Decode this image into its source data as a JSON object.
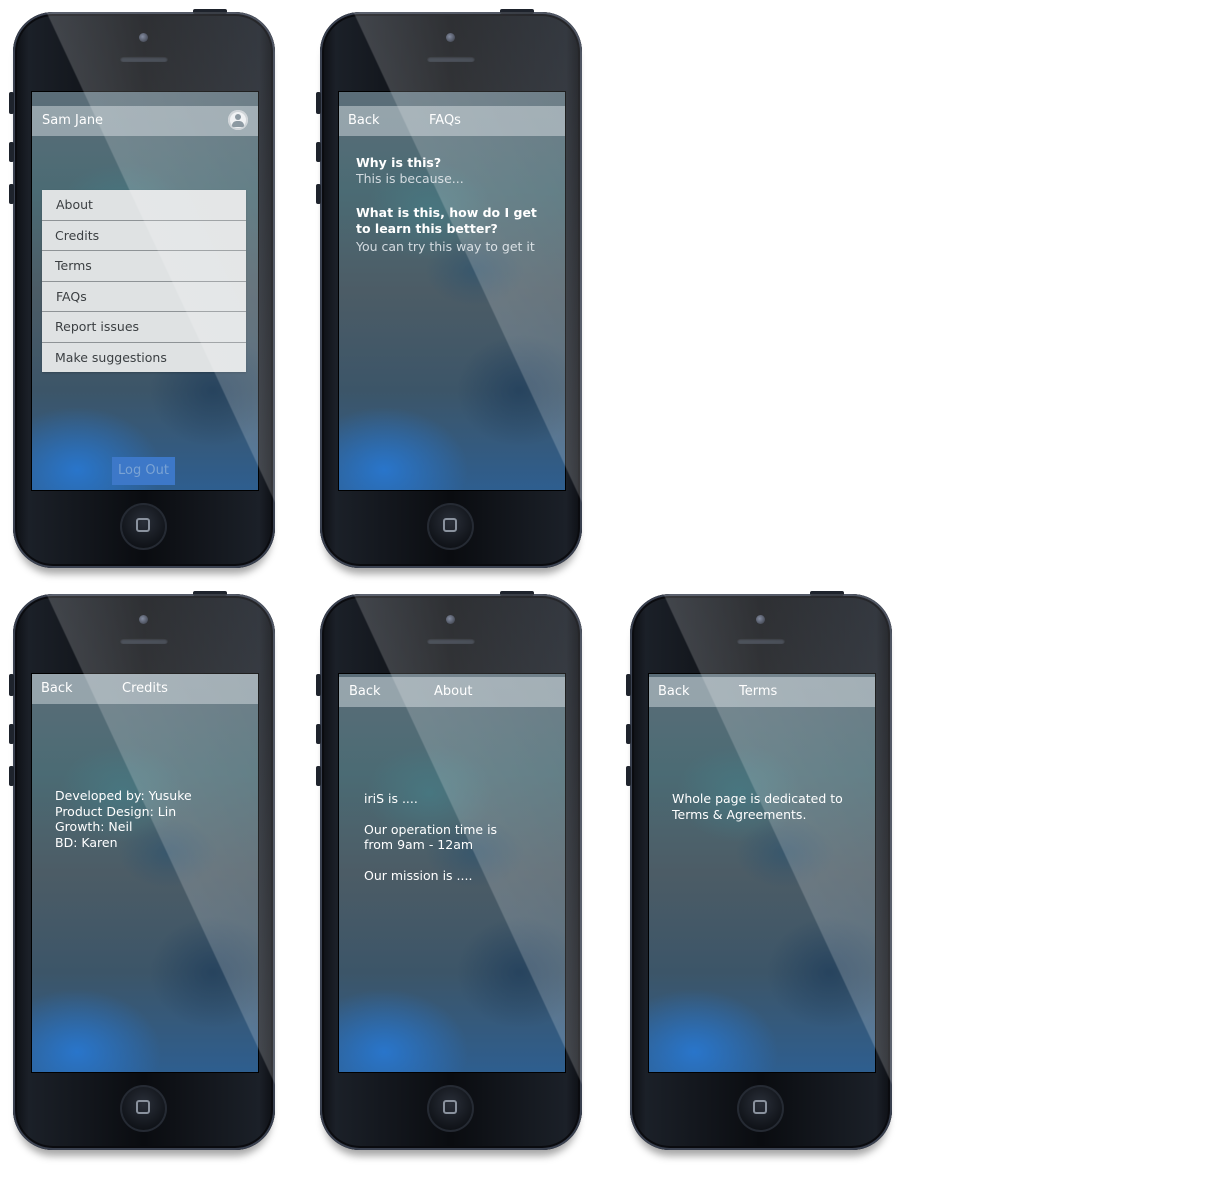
{
  "settings_screen": {
    "user_name": "Sam Jane",
    "menu": [
      "About",
      "Credits",
      "Terms",
      "FAQs",
      "Report issues",
      "Make suggestions"
    ],
    "logout_label": "Log Out"
  },
  "faqs_screen": {
    "back": "Back",
    "title": "FAQs",
    "items": [
      {
        "q": "Why is this?",
        "a": "This is because..."
      },
      {
        "q": "What is this, how do I get to learn this better?",
        "a": "You can try this way to get it"
      }
    ]
  },
  "credits_screen": {
    "back": "Back",
    "title": "Credits",
    "lines": [
      "Developed by: Yusuke",
      "Product Design: Lin",
      "Growth: Neil",
      "BD: Karen"
    ]
  },
  "about_screen": {
    "back": "Back",
    "title": "About",
    "p1": "iriS is ....",
    "p2": "Our operation time is from 9am - 12am",
    "p3": "Our mission is ...."
  },
  "terms_screen": {
    "back": "Back",
    "title": "Terms",
    "text": "Whole page is dedicated to Terms & Agreements."
  },
  "colors": {
    "accent_blue": "#3d78c8",
    "menu_bg": "#dfe2e3",
    "bar_bg": "#c8d2d7"
  }
}
